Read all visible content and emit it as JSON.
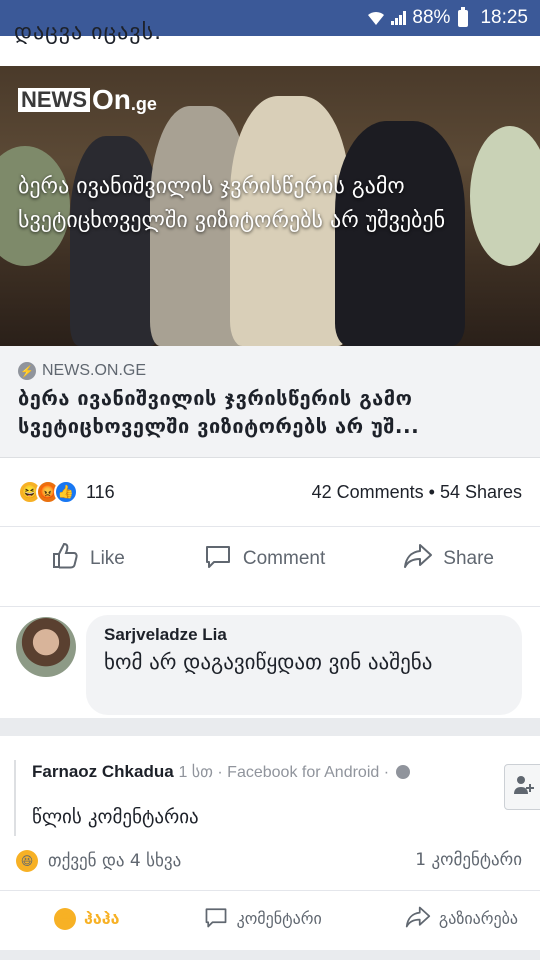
{
  "statusbar": {
    "battery": "88%",
    "time": "18:25"
  },
  "post1": {
    "cut_text": "დაცვა იცავს.",
    "hero": {
      "logo_news": "NEWS",
      "logo_on": "On",
      "logo_ge": ".ge",
      "headline": "ბერა ივანიშვილის ჯვრისწერის გამო სვეტიცხოველში ვიზიტორებს არ უშვებენ"
    },
    "link": {
      "source": "NEWS.ON.GE",
      "title_line1": "ბერა ივანიშვილის ჯვრისწერის გამო",
      "title_line2": "სვეტიცხოველში ვიზიტორებს არ უშ..."
    },
    "stats": {
      "reactions": "116",
      "comments": "42 Comments",
      "shares": "54 Shares"
    },
    "actions": {
      "like": "Like",
      "comment": "Comment",
      "share": "Share"
    },
    "comment": {
      "name": "Sarjveladze Lia",
      "text": "ხომ არ დაგავიწყდათ ვინ ააშენა"
    }
  },
  "post2": {
    "author": "Farnaoz Chkadua",
    "meta": "1 სთ · Facebook for Android ·",
    "text": "წლის კომენტარია",
    "reactions_text": "თქვენ და 4 სხვა",
    "comments_text": "1 კომენტარი",
    "actions": {
      "haha": "ჰაჰა",
      "comment": "კომენტარი",
      "share": "გაზიარება"
    }
  },
  "colors": {
    "facebook_blue": "#3b5998",
    "haha": "#f7b125",
    "like": "#1877f2"
  }
}
